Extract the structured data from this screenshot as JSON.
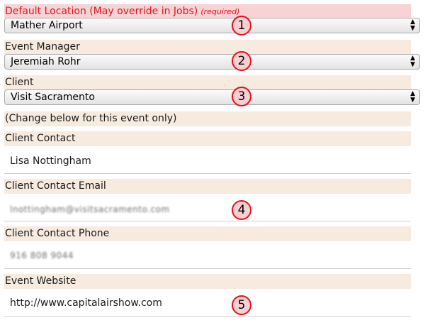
{
  "default_location": {
    "label": "Default Location (May override in Jobs)",
    "required_note": "(required)",
    "value": "Mather Airport"
  },
  "event_manager": {
    "label": "Event Manager",
    "value": "Jeremiah Rohr"
  },
  "client": {
    "label": "Client",
    "value": "Visit Sacramento"
  },
  "change_note": "(Change below for this event only)",
  "client_contact": {
    "label": "Client Contact",
    "value": "Lisa Nottingham"
  },
  "client_contact_email": {
    "label": "Client Contact Email",
    "value": "lnottingham@visitsacramento.com"
  },
  "client_contact_phone": {
    "label": "Client Contact Phone",
    "value": "916 808 9044"
  },
  "event_website": {
    "label": "Event Website",
    "value": "http://www.capitalairshow.com"
  },
  "badges": [
    "1",
    "2",
    "3",
    "4",
    "5"
  ],
  "colors": {
    "required_bg": "#f8d3d5",
    "required_text": "#e2131b",
    "label_bg": "#f6ebde",
    "badge_border": "#e2131b",
    "badge_fill": "#f9cfd2"
  }
}
